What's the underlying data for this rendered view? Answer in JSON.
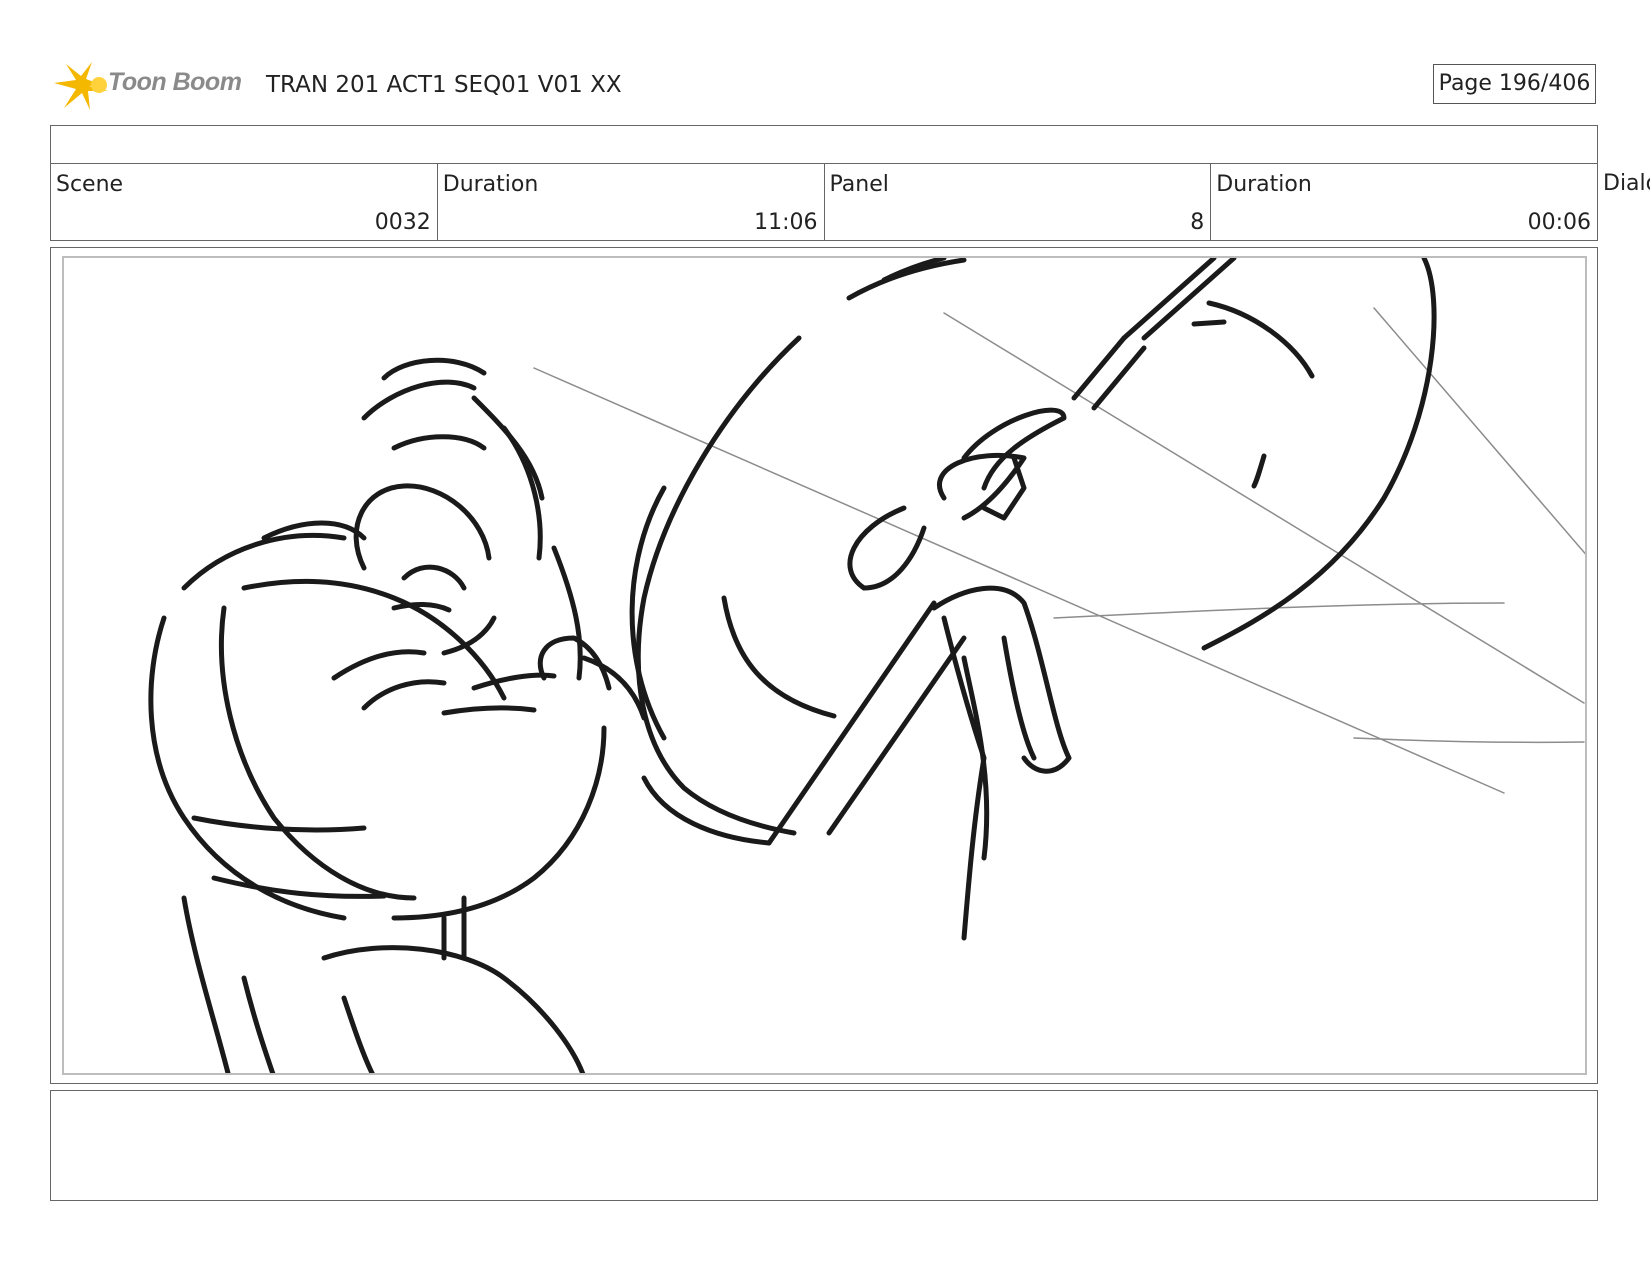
{
  "header": {
    "logo_text": "Toon Boom",
    "title": "TRAN 201 ACT1 SEQ01 V01 XX",
    "page": "Page 196/406"
  },
  "info": {
    "scene_label": "Scene",
    "scene_value": "0032",
    "scene_duration_label": "Duration",
    "scene_duration_value": "11:06",
    "panel_label": "Panel",
    "panel_value": "8",
    "panel_duration_label": "Duration",
    "panel_duration_value": "00:06",
    "dialog_label": "Dialog"
  },
  "colors": {
    "sketch_line": "#1a1a1a",
    "speed_line": "#8c8c8c",
    "logo_star": "#f5b800"
  },
  "icons": {
    "logo": "toon-boom-star-logo"
  }
}
